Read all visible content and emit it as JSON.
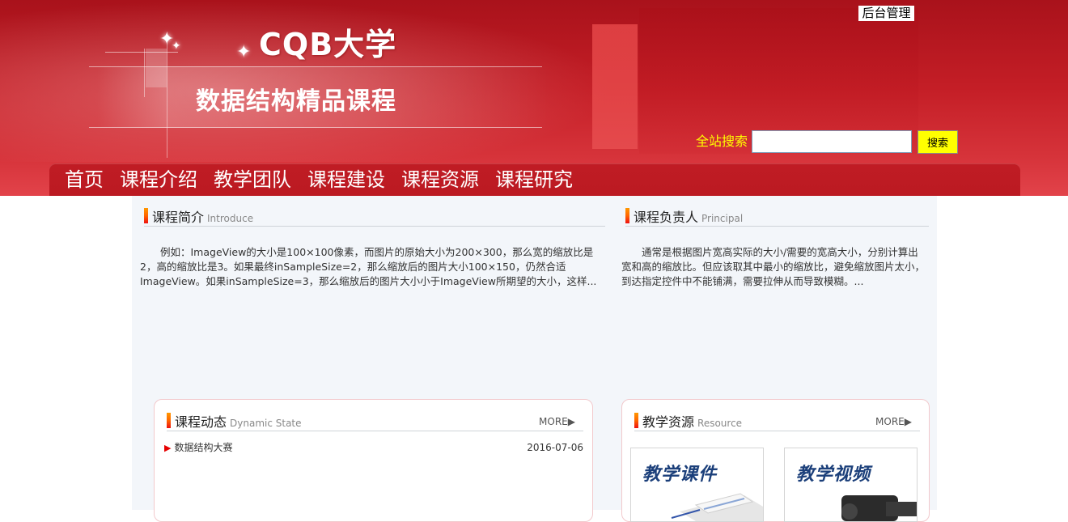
{
  "header": {
    "site_title": "CQB大学",
    "course_title": "数据结构精品课程",
    "admin_link": "后台管理",
    "search_label": "全站搜索",
    "search_value": "",
    "search_button": "搜索"
  },
  "nav": {
    "items": [
      "首页",
      "课程介绍",
      "教学团队",
      "课程建设",
      "课程资源",
      "课程研究"
    ]
  },
  "intro": {
    "title": "课程简介",
    "subtitle": "Introduce",
    "text": "例如：ImageView的大小是100×100像素，而图片的原始大小为200×300，那么宽的缩放比是2，高的缩放比是3。如果最终inSampleSize=2，那么缩放后的图片大小100×150，仍然合适ImageView。如果inSampleSize=3，那么缩放后的图片大小小于ImageView所期望的大小，这样..."
  },
  "principal": {
    "title": "课程负责人",
    "subtitle": "Principal",
    "text": "通常是根据图片宽高实际的大小/需要的宽高大小，分别计算出宽和高的缩放比。但应该取其中最小的缩放比，避免缩放图片太小，到达指定控件中不能铺满，需要拉伸从而导致模糊。..."
  },
  "news": {
    "title": "课程动态",
    "subtitle": "Dynamic State",
    "more": "MORE",
    "items": [
      {
        "title": "数据结构大赛",
        "date": "2016-07-06"
      }
    ]
  },
  "resources": {
    "title": "教学资源",
    "subtitle": "Resource",
    "more": "MORE",
    "cards": [
      {
        "label": "教学课件"
      },
      {
        "label": "教学视频"
      }
    ]
  },
  "colors": {
    "header_red": "#c41e26",
    "search_yellow": "#ffff00",
    "accent_orange": "#ff9900",
    "content_bg": "#f3f6fa"
  }
}
